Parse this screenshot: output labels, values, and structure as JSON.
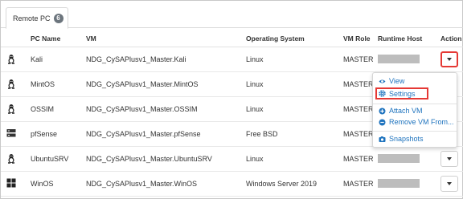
{
  "tabs": [
    {
      "label": "Remote PC",
      "badge": "6"
    }
  ],
  "table": {
    "headers": {
      "pc_name": "PC Name",
      "vm": "VM",
      "os": "Operating System",
      "role": "VM Role",
      "host": "Runtime Host",
      "action": "Action"
    },
    "rows": [
      {
        "icon": "linux-icon",
        "pc_name": "Kali",
        "vm": "NDG_CySAPlusv1_Master.Kali",
        "os": "Linux",
        "role": "MASTER"
      },
      {
        "icon": "linux-icon",
        "pc_name": "MintOS",
        "vm": "NDG_CySAPlusv1_Master.MintOS",
        "os": "Linux",
        "role": "MASTER"
      },
      {
        "icon": "linux-icon",
        "pc_name": "OSSIM",
        "vm": "NDG_CySAPlusv1_Master.OSSIM",
        "os": "Linux",
        "role": "MASTER"
      },
      {
        "icon": "server-icon",
        "pc_name": "pfSense",
        "vm": "NDG_CySAPlusv1_Master.pfSense",
        "os": "Free BSD",
        "role": "MASTER"
      },
      {
        "icon": "linux-icon",
        "pc_name": "UbuntuSRV",
        "vm": "NDG_CySAPlusv1_Master.UbuntuSRV",
        "os": "Linux",
        "role": "MASTER"
      },
      {
        "icon": "windows-icon",
        "pc_name": "WinOS",
        "vm": "NDG_CySAPlusv1_Master.WinOS",
        "os": "Windows Server 2019",
        "role": "MASTER"
      }
    ]
  },
  "menu": {
    "items": [
      {
        "label": "View",
        "icon": "eye-icon"
      },
      {
        "label": "Settings",
        "icon": "gear-icon"
      },
      {
        "label": "Attach VM",
        "icon": "plus-circle-icon"
      },
      {
        "label": "Remove VM From...",
        "icon": "minus-circle-icon"
      },
      {
        "label": "Snapshots",
        "icon": "camera-icon"
      }
    ]
  },
  "colors": {
    "link": "#1e73be",
    "highlight": "#e53935",
    "badge": "#6c757d",
    "redacted_host": "#bdbdbd"
  }
}
